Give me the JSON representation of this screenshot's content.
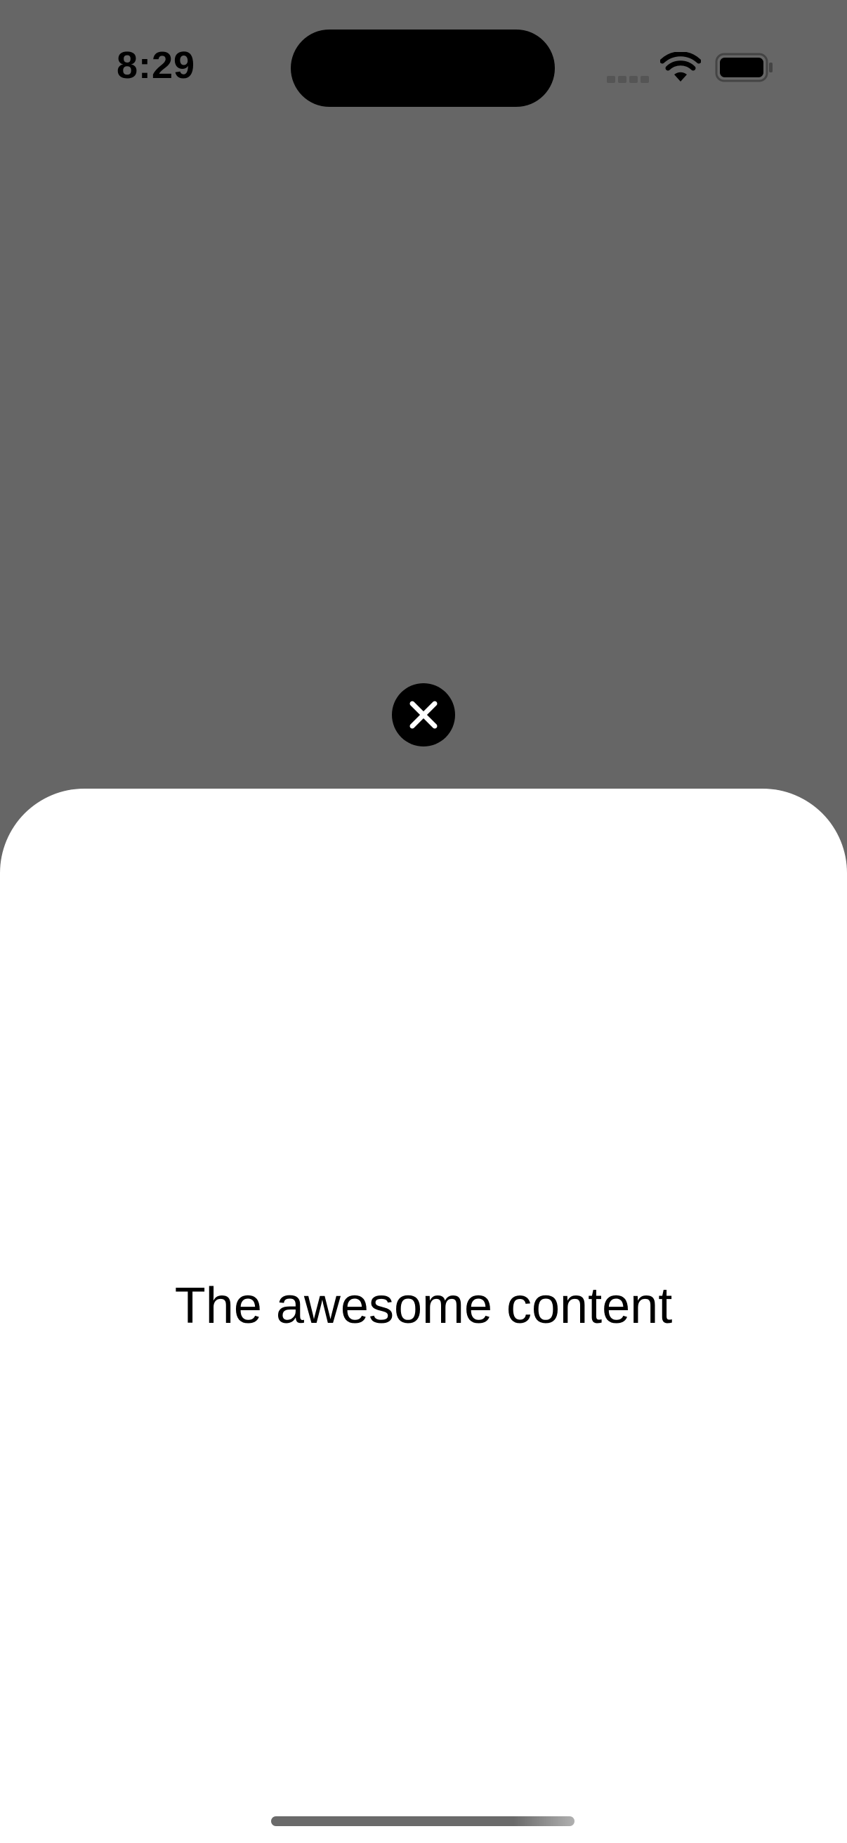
{
  "status_bar": {
    "time": "8:29",
    "icons": [
      "cellular-signal-icon",
      "wifi-icon",
      "battery-icon"
    ]
  },
  "overlay": {
    "close_icon": "close-icon",
    "background_color": "#666666"
  },
  "sheet": {
    "content_text": "The awesome content",
    "background_color": "#ffffff"
  }
}
